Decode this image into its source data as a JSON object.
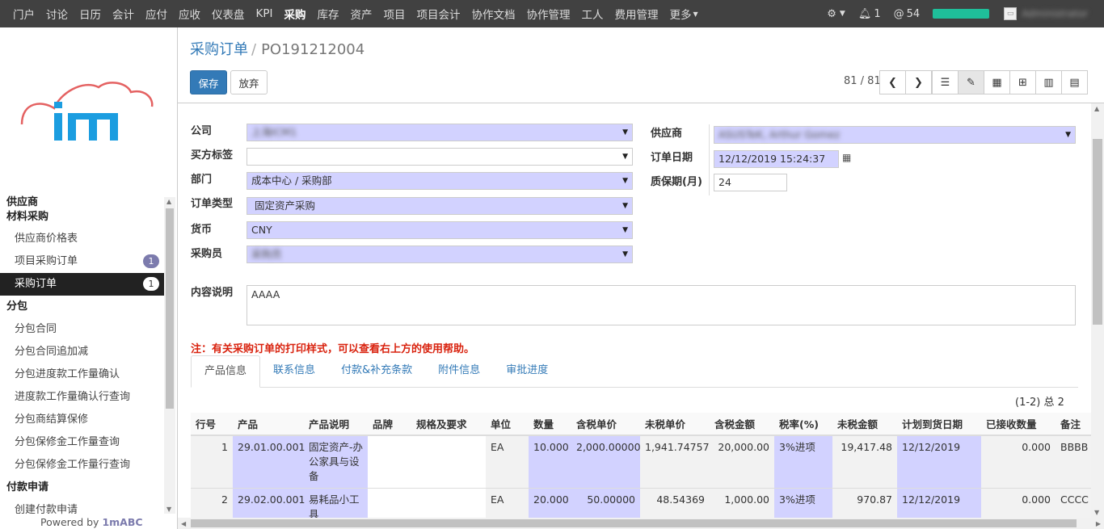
{
  "topnav": {
    "menu": [
      "门户",
      "讨论",
      "日历",
      "会计",
      "应付",
      "应收",
      "仪表盘",
      "KPI",
      "采购",
      "库存",
      "资产",
      "项目",
      "项目会计",
      "协作文档",
      "协作管理",
      "工人",
      "费用管理",
      "更多"
    ],
    "active": "采购",
    "notif_count": "1",
    "mention_count": "54",
    "user_name": "Administrator"
  },
  "sidebar": {
    "section1_title": "供应商",
    "section1_sub": "材料采购",
    "items1": [
      {
        "label": "供应商价格表"
      },
      {
        "label": "项目采购订单",
        "badge": "1"
      },
      {
        "label": "采购订单",
        "badge": "1",
        "active": true
      }
    ],
    "section2": "分包",
    "items2": [
      "分包合同",
      "分包合同追加减",
      "分包进度款工作量确认",
      "进度款工作量确认行查询",
      "分包商结算保修",
      "分包保修金工作量查询",
      "分包保修金工作量行查询"
    ],
    "section3": "付款申请",
    "items3": [
      "创建付款申请"
    ],
    "powered_prefix": "Powered by ",
    "powered_brand": "1mABC"
  },
  "breadcrumb": {
    "parent": "采购订单",
    "sep": "/",
    "current": "PO191212004"
  },
  "buttons": {
    "save": "保存",
    "discard": "放弃"
  },
  "pager": "81 / 81",
  "form": {
    "company_label": "公司",
    "company_value": "上海ICM1",
    "buyer_tag_label": "买方标签",
    "buyer_tag_value": "",
    "dept_label": "部门",
    "dept_value": "成本中心 / 采购部",
    "order_type_label": "订单类型",
    "order_type_value": "固定资产采购",
    "currency_label": "货币",
    "currency_value": "CNY",
    "buyer_label": "采购员",
    "buyer_value": "采购员",
    "vendor_label": "供应商",
    "vendor_value": "ASUSTeK, Arthur Gomez",
    "order_date_label": "订单日期",
    "order_date_value": "12/12/2019 15:24:37",
    "warranty_label": "质保期(月)",
    "warranty_value": "24",
    "content_label": "内容说明",
    "content_value": "AAAA"
  },
  "note": "注：有关采购订单的打印样式，可以查看右上方的使用帮助。",
  "tabs": [
    "产品信息",
    "联系信息",
    "付款&补充条款",
    "附件信息",
    "审批进度"
  ],
  "list_count": "(1-2) 总 2",
  "table": {
    "headers": [
      "行号",
      "产品",
      "产品说明",
      "品牌",
      "规格及要求",
      "单位",
      "数量",
      "含税单价",
      "未税单价",
      "含税金额",
      "税率(%)",
      "未税金额",
      "计划到货日期",
      "已接收数量",
      "备注"
    ],
    "rows": [
      [
        "1",
        "29.01.00.001",
        "固定资产-办公家具与设备",
        "",
        "",
        "EA",
        "10.000",
        "2,000.00000",
        "1,941.74757",
        "20,000.00",
        "3%进项",
        "19,417.48",
        "12/12/2019",
        "0.000",
        "BBBB"
      ],
      [
        "2",
        "29.02.00.001",
        "易耗品小工具",
        "",
        "",
        "EA",
        "20.000",
        "50.00000",
        "48.54369",
        "1,000.00",
        "3%进项",
        "970.87",
        "12/12/2019",
        "0.000",
        "CCCC"
      ]
    ]
  },
  "colors": {
    "topbar": "#414141",
    "primary": "#337ab7",
    "highlight": "#d2d2ff",
    "badge": "#7c7bad",
    "note": "#d9230f",
    "green": "#1fbf9a"
  }
}
